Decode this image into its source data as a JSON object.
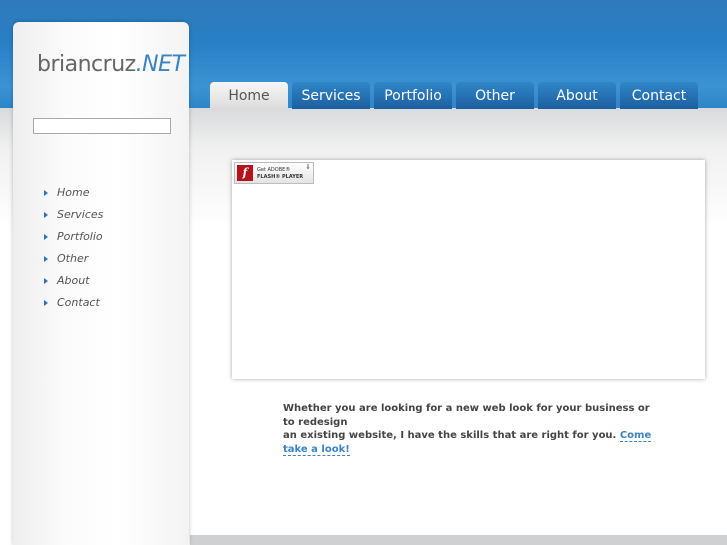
{
  "logo": {
    "name": "briancruz",
    "tld": ".NET"
  },
  "search": {
    "value": "",
    "placeholder": ""
  },
  "sidebar": {
    "items": [
      {
        "label": "Home"
      },
      {
        "label": "Services"
      },
      {
        "label": "Portfolio"
      },
      {
        "label": "Other"
      },
      {
        "label": "About"
      },
      {
        "label": "Contact"
      }
    ]
  },
  "tabs": [
    {
      "label": "Home",
      "active": true
    },
    {
      "label": "Services"
    },
    {
      "label": "Portfolio"
    },
    {
      "label": "Other"
    },
    {
      "label": "About"
    },
    {
      "label": "Contact"
    }
  ],
  "flash": {
    "line1": "Get ADOBE®",
    "line2": "FLASH® PLAYER",
    "icon": "flash-player-icon"
  },
  "intro": {
    "line1": "Whether you are looking for a new web look for your business or to redesign",
    "line2": "an existing website, I have the skills that are right for you.",
    "link": "Come take a look!"
  },
  "colors": {
    "header": "#2b82c8",
    "accent": "#3a82c4",
    "tab": "#1c5fa0"
  }
}
